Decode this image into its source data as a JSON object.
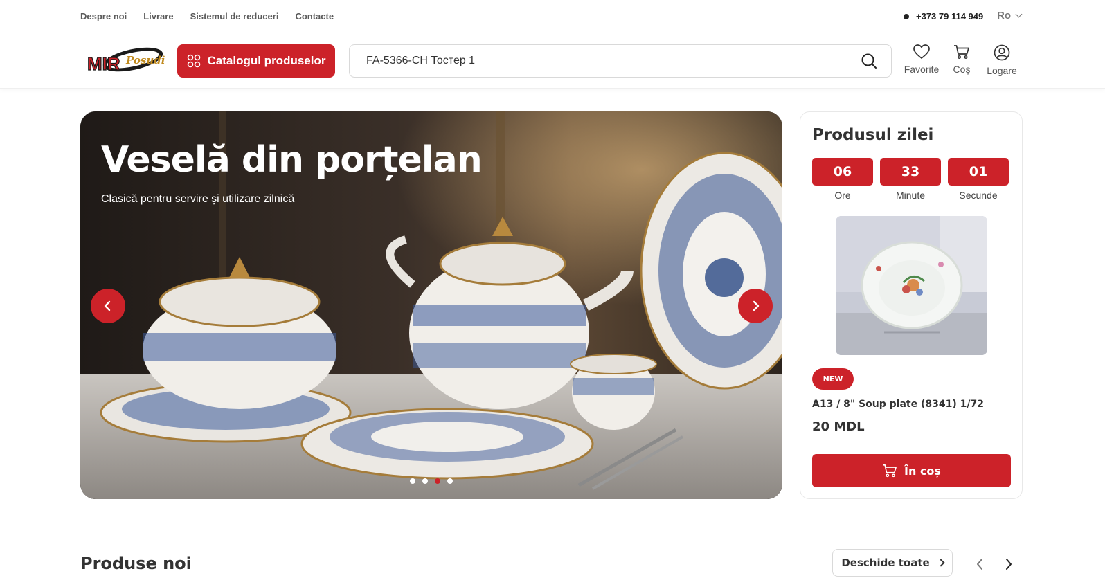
{
  "topnav": {
    "links": [
      "Despre noi",
      "Livrare",
      "Sistemul de reduceri",
      "Contacte"
    ],
    "phone": "+373 79 114 949",
    "language": "Ro"
  },
  "header": {
    "logo_text": "MIR Posudi",
    "catalog_label": "Catalogul produselor",
    "search_value": "FA-5366-CH Тостер 1",
    "icons": [
      {
        "label": "Favorite",
        "icon": "heart-icon"
      },
      {
        "label": "Coș",
        "icon": "cart-icon"
      },
      {
        "label": "Logare",
        "icon": "user-icon"
      }
    ]
  },
  "hero": {
    "title": "Veselă din porțelan",
    "subtitle": "Clasică pentru servire și utilizare zilnică",
    "slides": 4,
    "active_slide": 3
  },
  "product_of_day": {
    "title": "Produsul zilei",
    "timer": [
      {
        "value": "06",
        "label": "Ore"
      },
      {
        "value": "33",
        "label": "Minute"
      },
      {
        "value": "01",
        "label": "Secunde"
      }
    ],
    "badge": "NEW",
    "name": "A13 / 8\" Soup plate (8341) 1/72",
    "price": "20 MDL",
    "cart_label": "În coș"
  },
  "new_products": {
    "title": "Produse noi",
    "open_all_label": "Deschide toate"
  },
  "colors": {
    "accent": "#cc2229",
    "text": "#333333",
    "muted": "#5a5a5a",
    "border": "#d9d9d9"
  }
}
